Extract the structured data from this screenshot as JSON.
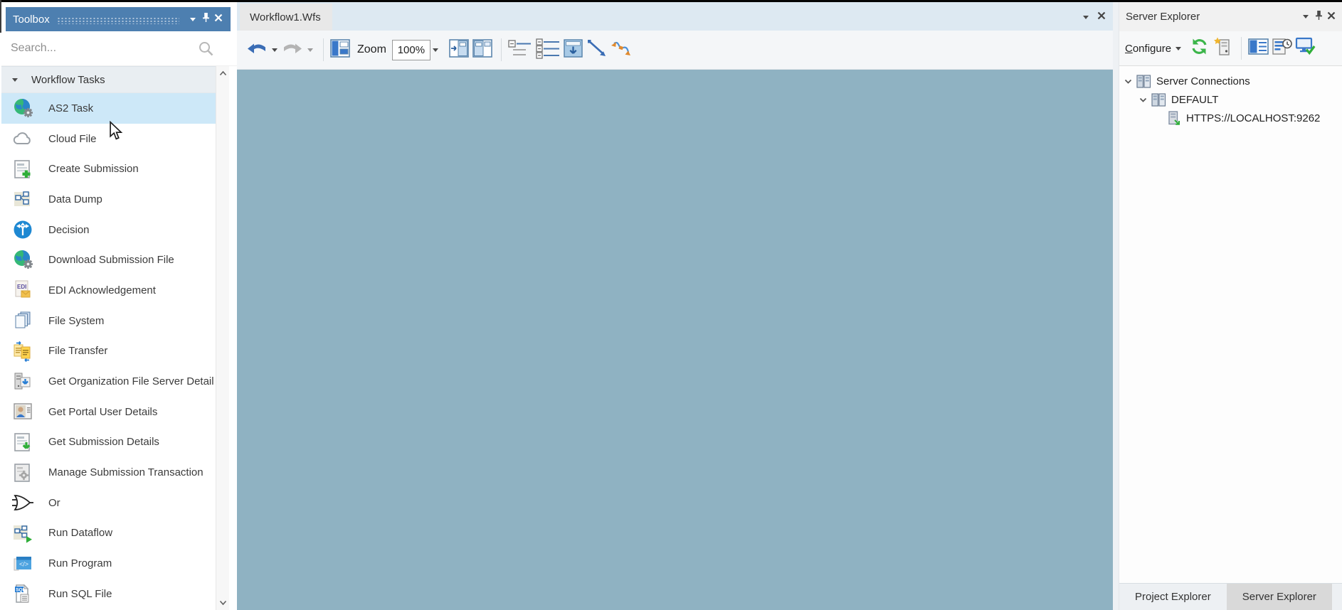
{
  "toolbox": {
    "title": "Toolbox",
    "search_placeholder": "Search...",
    "section_label": "Workflow Tasks",
    "items": [
      {
        "label": "AS2 Task",
        "icon": "globe-gear",
        "selected": true
      },
      {
        "label": "Cloud File",
        "icon": "cloud",
        "selected": false
      },
      {
        "label": "Create Submission",
        "icon": "document-plus",
        "selected": false
      },
      {
        "label": "Data Dump",
        "icon": "dataflow",
        "selected": false
      },
      {
        "label": "Decision",
        "icon": "decision-branch",
        "selected": false
      },
      {
        "label": "Download Submission File",
        "icon": "globe-gear",
        "selected": false
      },
      {
        "label": "EDI Acknowledgement",
        "icon": "edi-envelope",
        "selected": false
      },
      {
        "label": "File System",
        "icon": "file-stack",
        "selected": false
      },
      {
        "label": "File Transfer",
        "icon": "file-transfer",
        "selected": false
      },
      {
        "label": "Get Organization File Server Detail",
        "icon": "server-download",
        "selected": false
      },
      {
        "label": "Get Portal User Details",
        "icon": "user-card",
        "selected": false
      },
      {
        "label": "Get Submission Details",
        "icon": "document-download",
        "selected": false
      },
      {
        "label": "Manage Submission Transaction",
        "icon": "document-gear",
        "selected": false
      },
      {
        "label": "Or",
        "icon": "or-gate",
        "selected": false
      },
      {
        "label": "Run Dataflow",
        "icon": "dataflow-run",
        "selected": false
      },
      {
        "label": "Run Program",
        "icon": "code-window",
        "selected": false
      },
      {
        "label": "Run SQL File",
        "icon": "sql-document",
        "selected": false
      }
    ]
  },
  "editor": {
    "tab": "Workflow1.Wfs",
    "zoom_label": "Zoom",
    "zoom_value": "100%"
  },
  "server_explorer": {
    "title": "Server Explorer",
    "configure_initial": "C",
    "configure_rest": "onfigure",
    "tree": [
      {
        "label": "Server Connections",
        "icon": "servers",
        "level": 0,
        "expanded": true
      },
      {
        "label": "DEFAULT",
        "icon": "servers",
        "level": 1,
        "expanded": true
      },
      {
        "label": "HTTPS://LOCALHOST:9262",
        "icon": "server-link",
        "level": 2,
        "expanded": null
      }
    ],
    "bottom_tabs": [
      {
        "label": "Project Explorer",
        "active": false
      },
      {
        "label": "Server Explorer",
        "active": true
      }
    ]
  },
  "colors": {
    "toolbox_header": "#4d7fb0",
    "selection": "#cde8f8",
    "canvas": "#8fb2c2",
    "tabbar": "#dde9f2",
    "active_tab": "#e8e8e8",
    "accent_green": "#3cb54a"
  }
}
